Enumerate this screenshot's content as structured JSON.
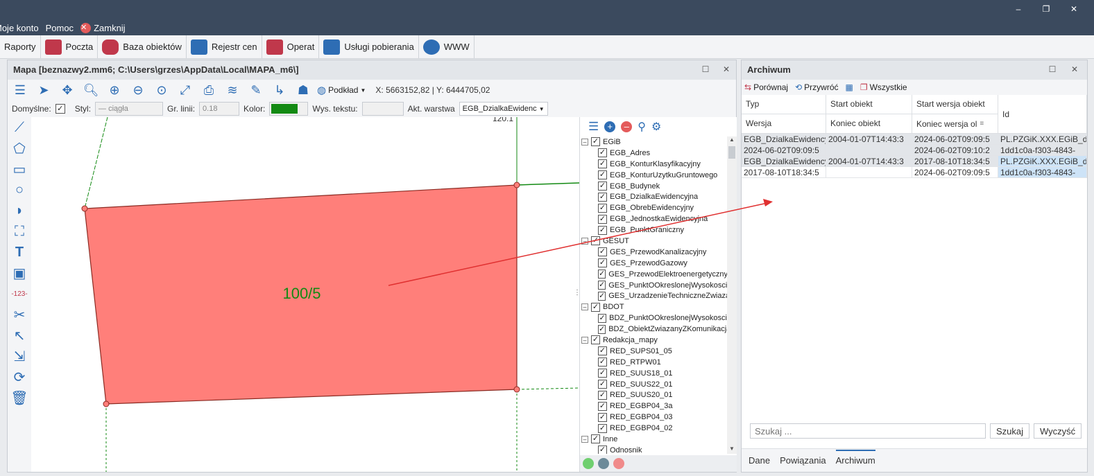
{
  "menu": {
    "my_account": "Moje konto",
    "help": "Pomoc",
    "close": "Zamknij"
  },
  "ribbon": {
    "tabs": [
      {
        "label": "Raporty",
        "icon": "report-icon",
        "color": ""
      },
      {
        "label": "Poczta",
        "icon": "mail-icon",
        "color": "#c0384b"
      },
      {
        "label": "Baza obiektów",
        "icon": "database-icon",
        "color": "#c0384b"
      },
      {
        "label": "Rejestr cen",
        "icon": "price-chart-icon",
        "color": "#2e6db4"
      },
      {
        "label": "Operat",
        "icon": "documents-icon",
        "color": "#c0384b"
      },
      {
        "label": "Usługi pobierania",
        "icon": "download-service-icon",
        "color": "#2e6db4"
      },
      {
        "label": "WWW",
        "icon": "globe-icon",
        "color": "#2e6db4"
      }
    ]
  },
  "map": {
    "title": "Mapa [beznazwy2.mm6; C:\\Users\\grzes\\AppData\\Local\\MAPA_m6\\]",
    "basemap_label": "Podkład",
    "coords": "X: 5663152,82 | Y: 6444705,02",
    "props": {
      "defaults_label": "Domyślne:",
      "style_label": "Styl:",
      "style_value": "ciągła",
      "line_width_label": "Gr. linii:",
      "line_width_value": "0.18",
      "color_label": "Kolor:",
      "color_value": "#138a13",
      "text_height_label": "Wys. tekstu:",
      "layer_label": "Akt. warstwa",
      "layer_value": "EGB_DzialkaEwidenc"
    },
    "parcel_label": "100/5",
    "top_label": "120.1",
    "parcel_fill": "#ff7f7a"
  },
  "layers": {
    "items": [
      {
        "label": "EGiB",
        "group": true
      },
      {
        "label": "EGB_Adres",
        "group": false
      },
      {
        "label": "EGB_KonturKlasyfikacyjny",
        "group": false
      },
      {
        "label": "EGB_KonturUzytkuGruntowego",
        "group": false
      },
      {
        "label": "EGB_Budynek",
        "group": false
      },
      {
        "label": "EGB_DzialkaEwidencyjna",
        "group": false
      },
      {
        "label": "EGB_ObrebEwidencyjny",
        "group": false
      },
      {
        "label": "EGB_JednostkaEwidencyjna",
        "group": false
      },
      {
        "label": "EGB_PunktGraniczny",
        "group": false
      },
      {
        "label": "GESUT",
        "group": true
      },
      {
        "label": "GES_PrzewodKanalizacyjny",
        "group": false
      },
      {
        "label": "GES_PrzewodGazowy",
        "group": false
      },
      {
        "label": "GES_PrzewodElektroenergetyczny",
        "group": false
      },
      {
        "label": "GES_PunktOOkreslonejWysokosci",
        "group": false
      },
      {
        "label": "GES_UrzadzenieTechniczneZwiazan",
        "group": false
      },
      {
        "label": "BDOT",
        "group": true
      },
      {
        "label": "BDZ_PunktOOkreslonejWysokosci",
        "group": false
      },
      {
        "label": "BDZ_ObiektZwiazanyZKomunikacja",
        "group": false
      },
      {
        "label": "Redakcja_mapy",
        "group": true
      },
      {
        "label": "RED_SUPS01_05",
        "group": false
      },
      {
        "label": "RED_RTPW01",
        "group": false
      },
      {
        "label": "RED_SUUS18_01",
        "group": false
      },
      {
        "label": "RED_SUUS22_01",
        "group": false
      },
      {
        "label": "RED_SUUS20_01",
        "group": false
      },
      {
        "label": "RED_EGBP04_3a",
        "group": false
      },
      {
        "label": "RED_EGBP04_03",
        "group": false
      },
      {
        "label": "RED_EGBP04_02",
        "group": false
      },
      {
        "label": "Inne",
        "group": true
      },
      {
        "label": "Odnosnik",
        "group": false
      }
    ],
    "legend_colors": [
      "#6fcf6f",
      "#6c8a99",
      "#f08a8a"
    ]
  },
  "archive": {
    "title": "Archiwum",
    "tools": {
      "compare": "Porównaj",
      "restore": "Przywróć",
      "all": "Wszystkie"
    },
    "headers": {
      "typ": "Typ",
      "start_obiekt": "Start obiekt",
      "start_wersja": "Start wersja obiekt",
      "id": "Id",
      "wersja": "Wersja",
      "koniec_obiekt": "Koniec obiekt",
      "koniec_wersja": "Koniec wersja ol"
    },
    "rows": [
      {
        "typ": "EGB_DzialkaEwidency",
        "start_obiekt": "2004-01-07T14:43:3",
        "start_wersja": "2024-06-02T09:09:5",
        "id1": "PL.PZGiK.XXX.EGiB_d",
        "wersja": "2024-06-02T09:09:5",
        "koniec_obiekt": "",
        "koniec_wersja": "2024-06-02T09:10:2",
        "id2": "1dd1c0a-f303-4843-"
      },
      {
        "typ": "EGB_DzialkaEwidency",
        "start_obiekt": "2004-01-07T14:43:3",
        "start_wersja": "2017-08-10T18:34:5",
        "id1": "PL.PZGiK.XXX.EGiB_d",
        "wersja": "2017-08-10T18:34:5",
        "koniec_obiekt": "",
        "koniec_wersja": "2024-06-02T09:09:5",
        "id2": "1dd1c0a-f303-4843-"
      }
    ],
    "search_placeholder": "Szukaj ...",
    "search_button": "Szukaj",
    "clear_button": "Wyczyść",
    "bottom_tabs": [
      "Dane",
      "Powiązania",
      "Archiwum"
    ]
  }
}
